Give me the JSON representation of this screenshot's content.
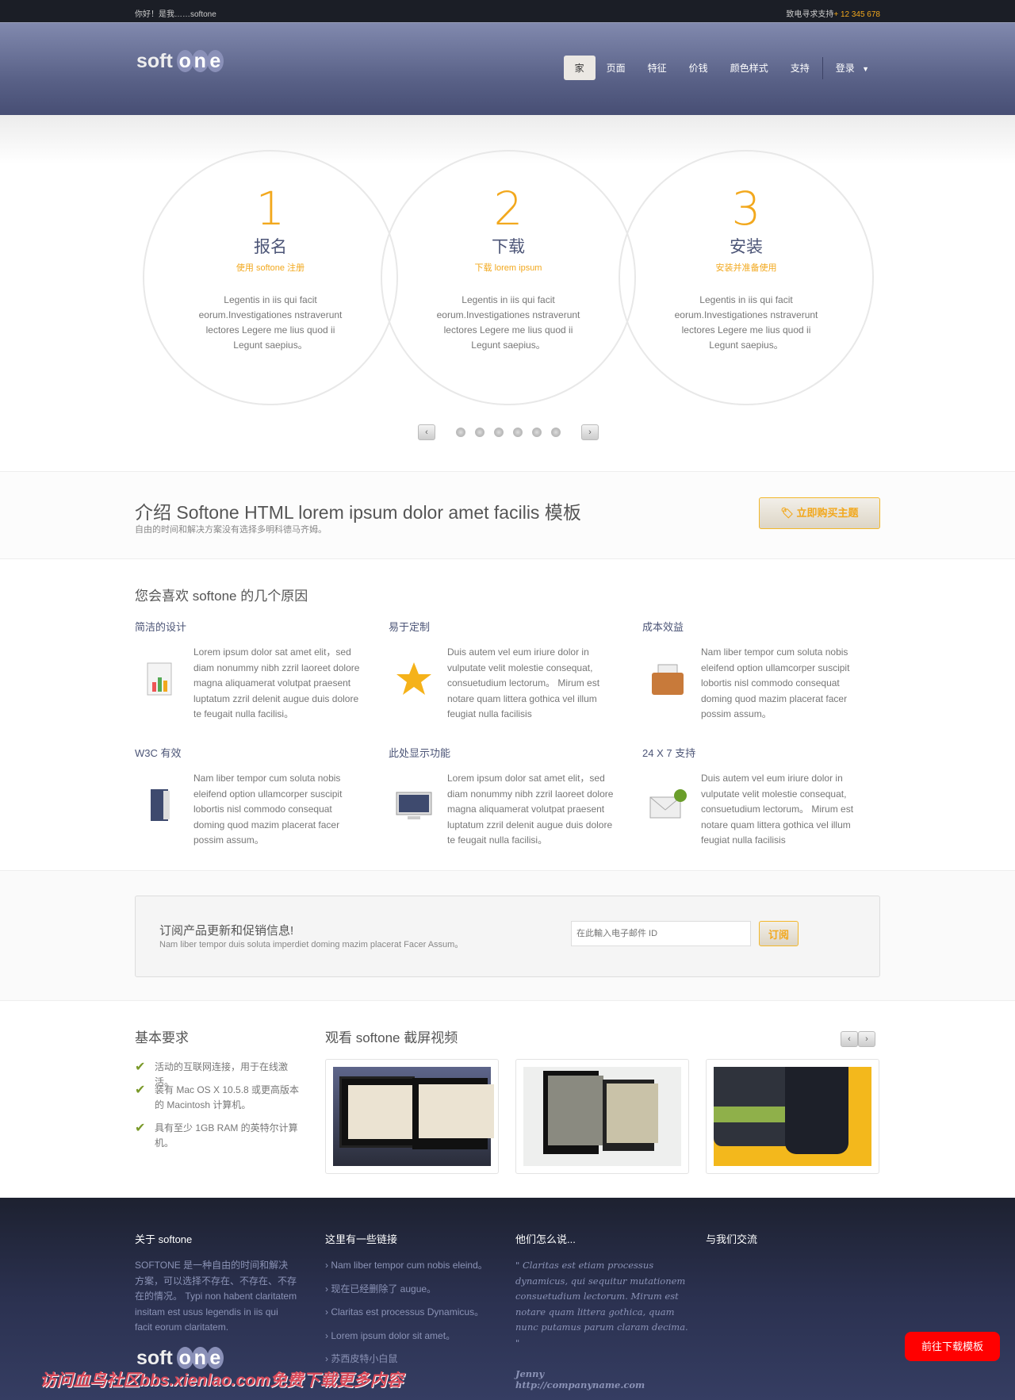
{
  "topbar": {
    "greeting": "你好！是我……softone",
    "support_label": "致电寻求支持",
    "phone": "+ 12 345 678"
  },
  "logo": {
    "text_soft": "soft",
    "text_o": "o",
    "text_n": "n",
    "text_e": "e"
  },
  "nav": {
    "items": [
      "家",
      "页面",
      "特征",
      "价钱",
      "颜色样式",
      "支持"
    ],
    "login": "登录",
    "active": "家"
  },
  "steps": [
    {
      "num": "1",
      "title": "报名",
      "subtitle": "使用 softone 注册",
      "desc": "Legentis in iis qui facit eorum.Investigationes nstraverunt lectores Legere me lius quod ii Legunt saepius。"
    },
    {
      "num": "2",
      "title": "下载",
      "subtitle": "下载 lorem ipsum",
      "desc": "Legentis in iis qui facit eorum.Investigationes nstraverunt lectores Legere me lius quod ii Legunt saepius。"
    },
    {
      "num": "3",
      "title": "安装",
      "subtitle": "安装并准备使用",
      "desc": "Legentis in iis qui facit eorum.Investigationes nstraverunt lectores Legere me lius quod ii Legunt saepius。"
    }
  ],
  "pager": {
    "prev": "‹",
    "next": "›",
    "dots": 6
  },
  "intro": {
    "title": "介绍 Softone HTML lorem ipsum dolor amet facilis 模板",
    "subtitle": "自由的时间和解决方案没有选择多明科德马齐姆。",
    "buy_label": "立即购买主题"
  },
  "reasons": {
    "title": "您会喜欢 softone 的几个原因",
    "items": [
      {
        "title": "简洁的设计",
        "icon": "document-chart-icon",
        "text": "Lorem ipsum dolor sat amet elit，sed diam nonummy nibh zzril laoreet dolore magna aliquamerat volutpat praesent luptatum zzril delenit augue duis dolore te feugait nulla facilisi。"
      },
      {
        "title": "易于定制",
        "icon": "star-icon",
        "text": "Duis autem vel eum iriure dolor in vulputate velit molestie consequat, consuetudium lectorum。 Mirum est notare quam littera gothica vel illum feugiat nulla facilisis"
      },
      {
        "title": "成本效益",
        "icon": "briefcase-icon",
        "text": "Nam liber tempor cum soluta nobis eleifend option ullamcorper suscipit lobortis nisl commodo consequat doming quod mazim placerat facer possim assum。"
      },
      {
        "title": "W3C 有效",
        "icon": "book-icon",
        "text": "Nam liber tempor cum soluta nobis eleifend option ullamcorper suscipit lobortis nisl commodo consequat doming quod mazim placerat facer possim assum。"
      },
      {
        "title": "此处显示功能",
        "icon": "monitor-icon",
        "text": "Lorem ipsum dolor sat amet elit，sed diam nonummy nibh zzril laoreet dolore magna aliquamerat volutpat praesent luptatum zzril delenit augue duis dolore te feugait nulla facilisi。"
      },
      {
        "title": "24 X 7 支持",
        "icon": "mail-check-icon",
        "text": "Duis autem vel eum iriure dolor in vulputate velit molestie consequat, consuetudium lectorum。 Mirum est notare quam littera gothica vel illum feugiat nulla facilisis"
      }
    ]
  },
  "subscribe": {
    "title": "订阅产品更新和促销信息!",
    "desc": "Nam liber tempor duis soluta imperdiet doming mazim placerat Facer Assum。",
    "placeholder": "在此輸入电子邮件 ID",
    "button": "订阅"
  },
  "requirements": {
    "title": "基本要求",
    "items": [
      "活动的互联网连接，用于在线激活。",
      "装有 Mac OS X 10.5.8 或更高版本的 Macintosh 计算机。",
      "具有至少 1GB RAM 的英特尔计算机。"
    ]
  },
  "videos": {
    "title": "观看 softone 截屏视频",
    "prev": "‹",
    "next": "›"
  },
  "footer": {
    "about_title": "关于 softone",
    "about_text": "SOFTONE 是一种自由的时间和解决方案，可以选择不存在、不存在、不存在的情况。 Typi non habent claritatem insitam est usus legendis in iis qui facit eorum claritatem.",
    "links_title": "这里有一些链接",
    "links": [
      "Nam liber tempor cum nobis eleind。",
      "现在已经删除了 augue。",
      "Claritas est processus Dynamicus。",
      "Lorem ipsum dolor sit amet。",
      "苏西皮特小白鼠"
    ],
    "quote_title": "他们怎么说...",
    "quote": "\" Claritas est etiam processus dynamicus, qui sequitur mutationem consuetudium lectorum. Mirum est notare quam littera gothica, quam nunc putamus parum claram decima. \"",
    "author": "Jenny",
    "author_url": "http://companyname.com",
    "contact_title": "与我们交流"
  },
  "download_button": "前往下载模板",
  "watermark": "访问血鸟社区bbs.xienlao.com免费下载更多内容",
  "colors": {
    "accent": "#f2a81d",
    "header": "#5a6288",
    "footer": "#2b3150",
    "download": "#ff0000"
  }
}
